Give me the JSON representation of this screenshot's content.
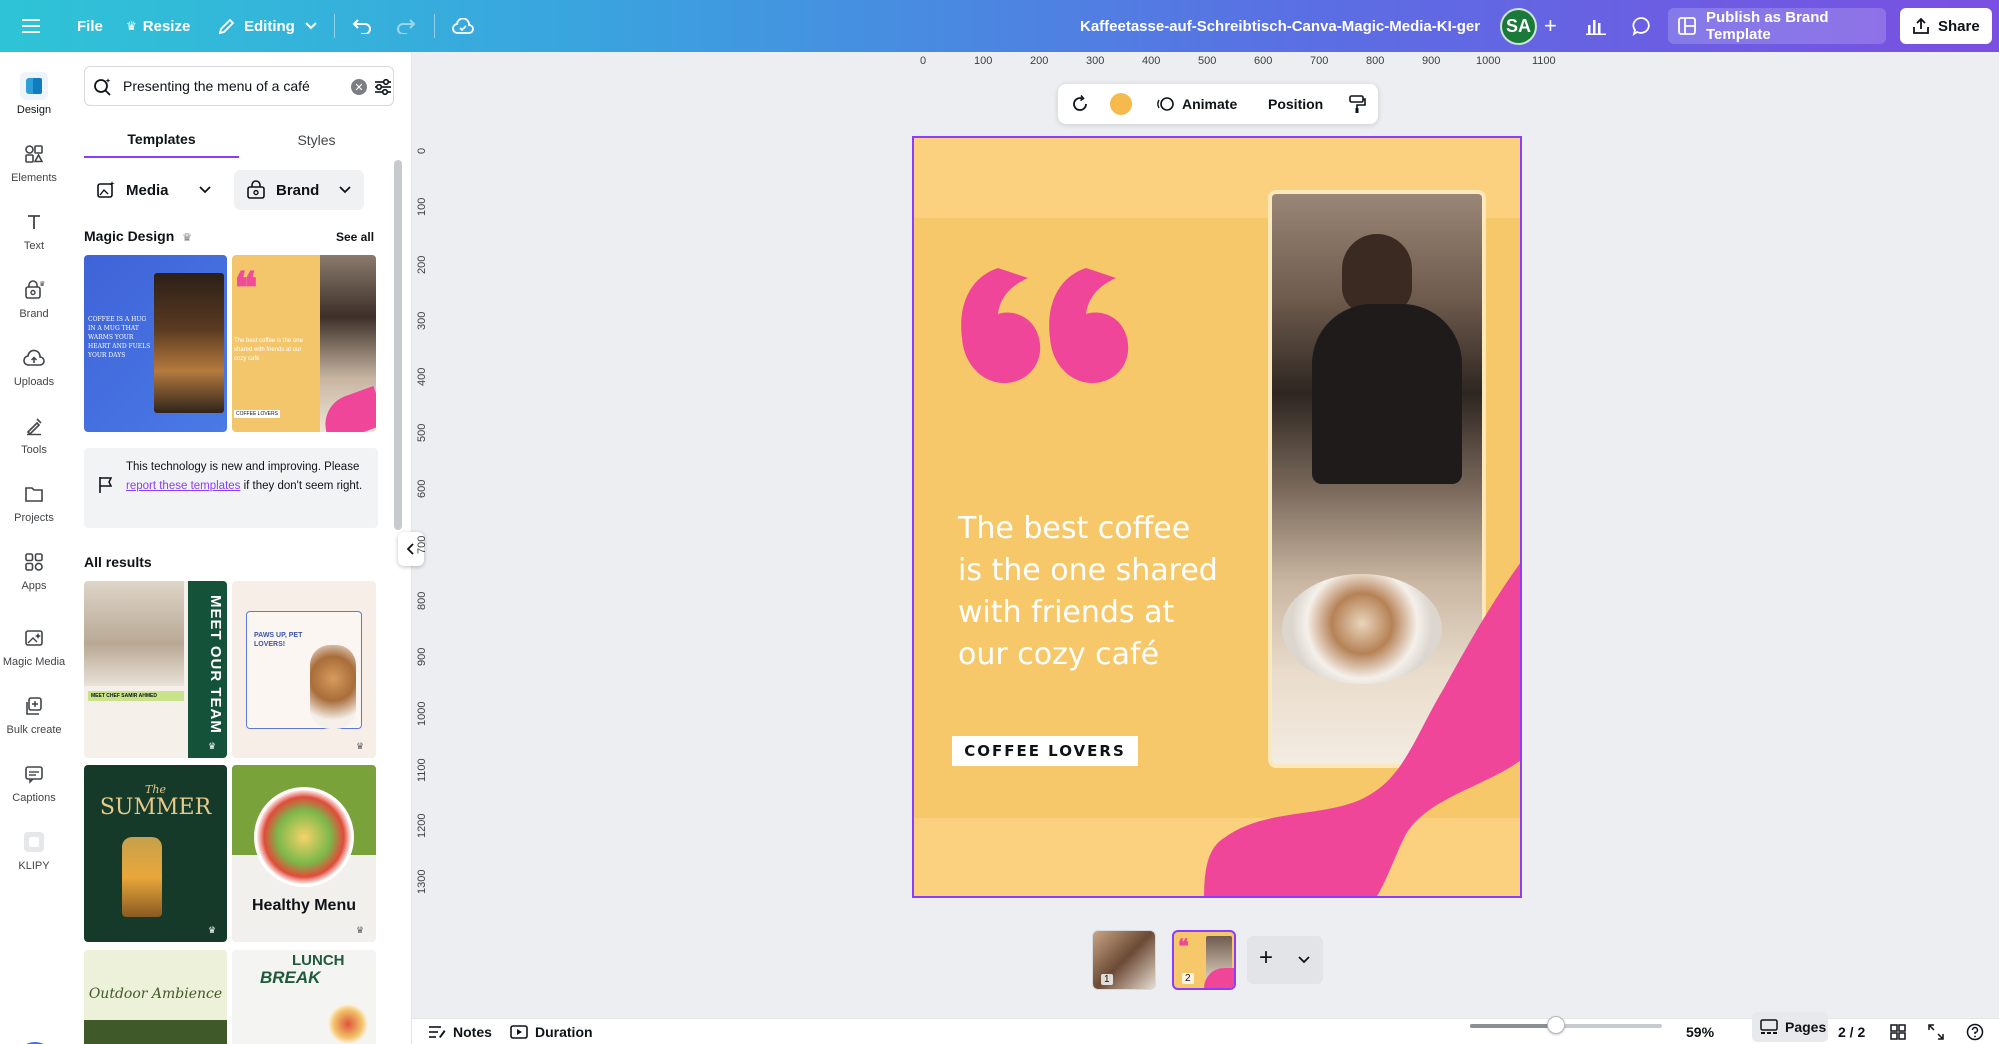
{
  "topbar": {
    "file_label": "File",
    "resize_label": "Resize",
    "editing_label": "Editing",
    "doc_title": "Kaffeetasse-auf-Schreibtisch-Canva-Magic-Media-KI-generi...",
    "avatar_initials": "SA",
    "publish_label": "Publish as Brand Template",
    "share_label": "Share"
  },
  "rail": {
    "items": [
      {
        "label": "Design",
        "icon": "design-icon"
      },
      {
        "label": "Elements",
        "icon": "elements-icon"
      },
      {
        "label": "Text",
        "icon": "text-icon"
      },
      {
        "label": "Brand",
        "icon": "brand-icon"
      },
      {
        "label": "Uploads",
        "icon": "upload-cloud-icon"
      },
      {
        "label": "Tools",
        "icon": "tools-icon"
      },
      {
        "label": "Projects",
        "icon": "folder-icon"
      },
      {
        "label": "Apps",
        "icon": "apps-icon"
      },
      {
        "label": "Magic Media",
        "icon": "magic-media-icon"
      },
      {
        "label": "Bulk create",
        "icon": "bulk-create-icon"
      },
      {
        "label": "Captions",
        "icon": "captions-icon"
      },
      {
        "label": "KLIPY",
        "icon": "klipy-icon"
      }
    ]
  },
  "panel": {
    "search_value": "Presenting the menu of a café",
    "tabs": [
      "Templates",
      "Styles"
    ],
    "filters": {
      "media": "Media",
      "brand": "Brand"
    },
    "magic_design_title": "Magic Design",
    "see_all": "See all",
    "notice": {
      "line1": "This technology is new and improving.",
      "pre_link": "Please ",
      "link": "report these templates",
      "post_link": " if they don't seem right."
    },
    "all_results_title": "All results",
    "templates": {
      "t1_text": "COFFEE IS A HUG IN A MUG THAT WARMS YOUR HEART AND FUELS YOUR DAYS",
      "t2_text": "The best coffee is the one shared with friends at our cozy café",
      "t2_tag": "COFFEE LOVERS",
      "team_title": "MEET OUR TEAM",
      "team_sub": "MEET CHEF SAMIR AHMED",
      "paws_title": "PAWS UP, PET LOVERS!",
      "summer_the": "The",
      "summer_title": "SUMMER",
      "healthy_title": "Healthy Menu",
      "outdoor_title": "Outdoor Ambience",
      "lunch_title": "LUNCH",
      "break_title": "BREAK"
    }
  },
  "ruler": {
    "h": [
      "0",
      "100",
      "200",
      "300",
      "400",
      "500",
      "600",
      "700",
      "800",
      "900",
      "1000",
      "1100"
    ],
    "v": [
      "0",
      "100",
      "200",
      "300",
      "400",
      "500",
      "600",
      "700",
      "800",
      "900",
      "1000",
      "1100",
      "1200",
      "1300"
    ]
  },
  "context_toolbar": {
    "animate_label": "Animate",
    "position_label": "Position",
    "color": "#f5b94c"
  },
  "design": {
    "quote_text": "The best coffee is the one shared with friends at our cozy café",
    "tag_text": "COFFEE LOVERS",
    "background": "#f7c869",
    "accent_pink": "#f0469a"
  },
  "pages": {
    "thumb1_num": "1",
    "thumb2_num": "2"
  },
  "bottombar": {
    "notes_label": "Notes",
    "duration_label": "Duration",
    "zoom": "59%",
    "zoom_fraction": 0.45,
    "pages_label": "Pages",
    "page_count": "2 / 2"
  }
}
